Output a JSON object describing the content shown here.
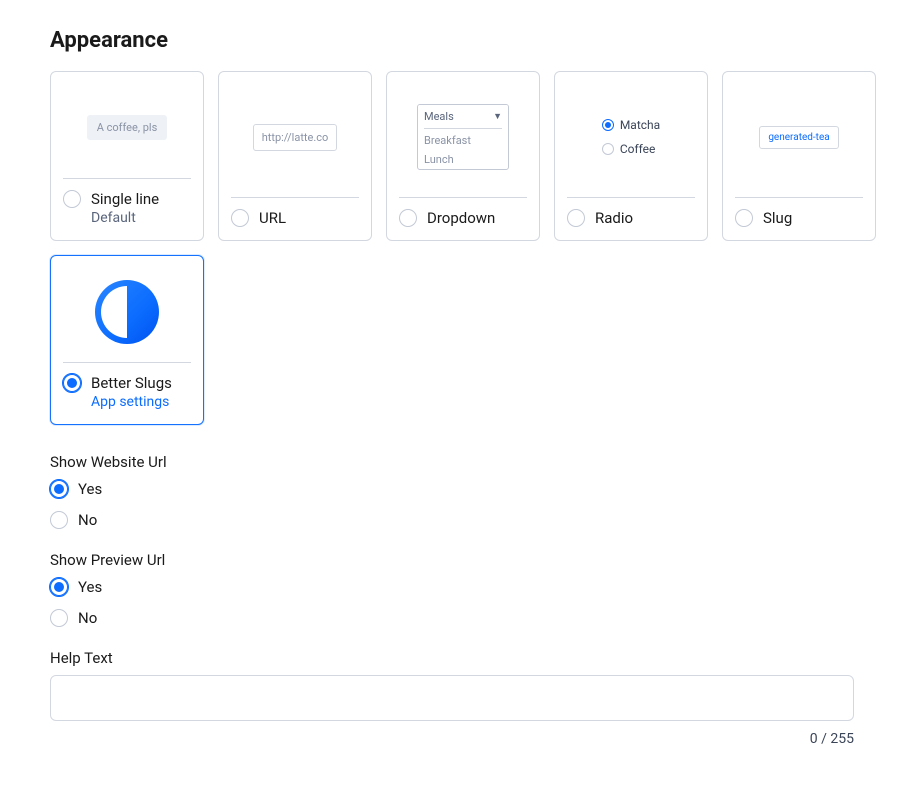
{
  "title": "Appearance",
  "cards": [
    {
      "id": "single-line",
      "label": "Single line",
      "sublabel": "Default",
      "preview_text": "A coffee, pls",
      "selected": false
    },
    {
      "id": "url",
      "label": "URL",
      "preview_text": "http://latte.co",
      "selected": false
    },
    {
      "id": "dropdown",
      "label": "Dropdown",
      "dd_label": "Meals",
      "dd_opts": [
        "Breakfast",
        "Lunch"
      ],
      "selected": false
    },
    {
      "id": "radio",
      "label": "Radio",
      "radio_opts": [
        "Matcha",
        "Coffee"
      ],
      "radio_selected": 0,
      "selected": false
    },
    {
      "id": "slug",
      "label": "Slug",
      "preview_text": "generated-tea",
      "selected": false
    },
    {
      "id": "better-slugs",
      "label": "Better Slugs",
      "sublabel": "App settings",
      "selected": true
    }
  ],
  "groups": {
    "website": {
      "label": "Show Website Url",
      "yes": "Yes",
      "no": "No",
      "value": "yes"
    },
    "preview": {
      "label": "Show Preview Url",
      "yes": "Yes",
      "no": "No",
      "value": "yes"
    }
  },
  "help": {
    "label": "Help Text",
    "value": "",
    "count": "0",
    "max": "255",
    "separator": " / "
  }
}
